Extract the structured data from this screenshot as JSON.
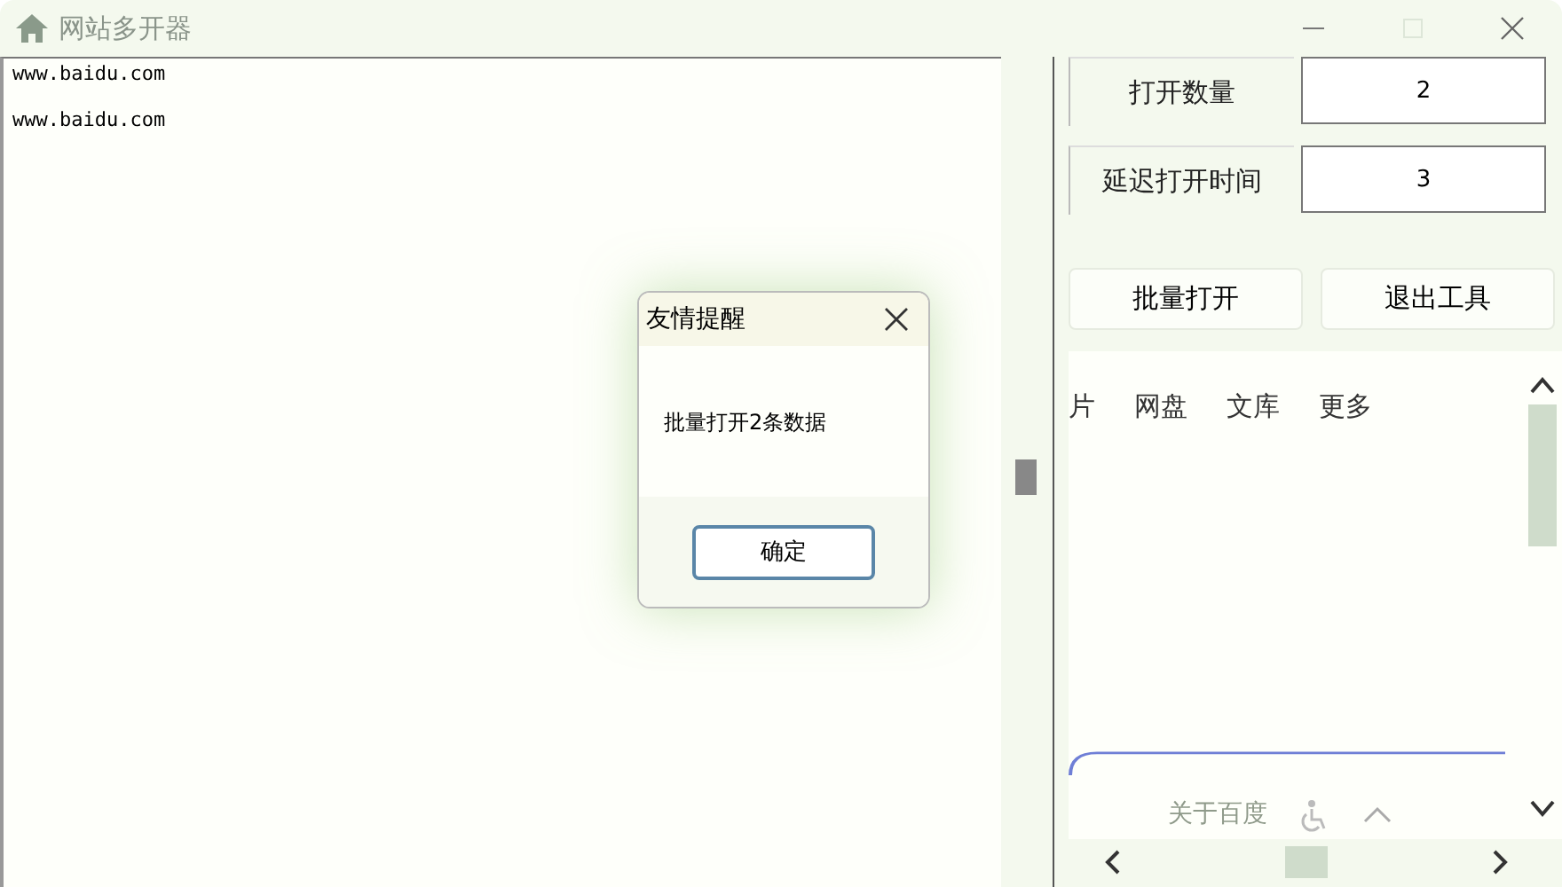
{
  "window": {
    "title": "网站多开器"
  },
  "urls": [
    "www.baidu.com",
    "www.baidu.com"
  ],
  "settings": [
    {
      "label": "打开数量",
      "value": "2"
    },
    {
      "label": "延迟打开时间",
      "value": "3"
    }
  ],
  "buttons": [
    "批量打开",
    "退出工具"
  ],
  "browser": {
    "nav_links": [
      "片",
      "网盘",
      "文库",
      "更多"
    ],
    "footer_link": "关于百度"
  },
  "dialog": {
    "title": "友情提醒",
    "message": "批量打开2条数据",
    "button": "确定"
  }
}
